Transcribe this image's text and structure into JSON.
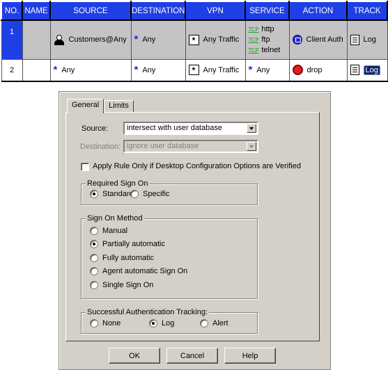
{
  "rule_table": {
    "headers": [
      "NO.",
      "NAME",
      "SOURCE",
      "DESTINATION",
      "VPN",
      "SERVICE",
      "ACTION",
      "TRACK"
    ],
    "rows": [
      {
        "no": "1",
        "name": "",
        "source": "Customers@Any",
        "destination": "Any",
        "vpn": "Any Traffic",
        "services": [
          {
            "protocol": "TCP",
            "name": "http"
          },
          {
            "protocol": "TCP",
            "name": "ftp"
          },
          {
            "protocol": "TCP",
            "name": "telnet"
          }
        ],
        "action": "Client Auth",
        "track": "Log"
      },
      {
        "no": "2",
        "name": "",
        "source": "Any",
        "destination": "Any",
        "vpn": "Any Traffic",
        "service": "Any",
        "action": "drop",
        "track": "Log"
      }
    ]
  },
  "dialog": {
    "tabs": [
      "General",
      "Limits"
    ],
    "active_tab": "General",
    "source_label": "Source:",
    "source_value": "intersect with user database",
    "destination_label": "Destination:",
    "destination_value": "ignore user database",
    "apply_rule_checkbox": {
      "label": "Apply Rule Only if Desktop Configuration Options are Verified",
      "checked": false
    },
    "required_sign_on": {
      "title": "Required Sign On",
      "options": [
        {
          "label": "Standard",
          "selected": true
        },
        {
          "label": "Specific",
          "selected": false
        }
      ]
    },
    "sign_on_method": {
      "title": "Sign On Method",
      "options": [
        {
          "label": "Manual",
          "selected": false
        },
        {
          "label": "Partially automatic",
          "selected": true
        },
        {
          "label": "Fully automatic",
          "selected": false
        },
        {
          "label": "Agent automatic Sign On",
          "selected": false
        },
        {
          "label": "Single Sign On",
          "selected": false
        }
      ]
    },
    "auth_tracking": {
      "title": "Successful Authentication Tracking:",
      "options": [
        {
          "label": "None",
          "selected": false
        },
        {
          "label": "Log",
          "selected": true
        },
        {
          "label": "Alert",
          "selected": false
        }
      ]
    },
    "buttons": {
      "ok": "OK",
      "cancel": "Cancel",
      "help": "Help"
    }
  },
  "colors": {
    "header_blue": "#1f3fe6",
    "dialog_gray": "#d4d0c8",
    "selected_row_gray": "#c6c3c6"
  }
}
